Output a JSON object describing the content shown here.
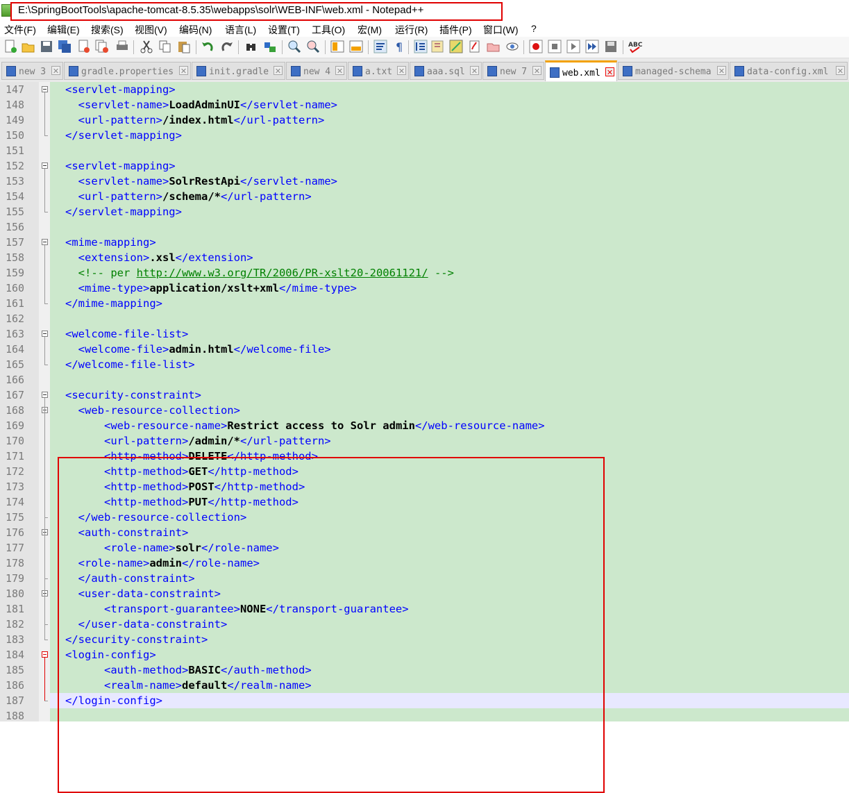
{
  "window": {
    "title": "E:\\SpringBootTools\\apache-tomcat-8.5.35\\webapps\\solr\\WEB-INF\\web.xml - Notepad++"
  },
  "menu": {
    "items": [
      "文件(F)",
      "编辑(E)",
      "搜索(S)",
      "视图(V)",
      "编码(N)",
      "语言(L)",
      "设置(T)",
      "工具(O)",
      "宏(M)",
      "运行(R)",
      "插件(P)",
      "窗口(W)",
      "?"
    ]
  },
  "toolbar": {
    "icons": [
      "new-file-icon",
      "open-file-icon",
      "save-icon",
      "save-all-icon",
      "close-icon",
      "close-all-icon",
      "print-icon",
      "cut-icon",
      "copy-icon",
      "paste-icon",
      "undo-icon",
      "redo-icon",
      "find-icon",
      "replace-icon",
      "zoom-in-icon",
      "zoom-out-icon",
      "sync-vertical-icon",
      "sync-horizontal-icon",
      "word-wrap-icon",
      "show-all-chars-icon",
      "indent-guide-icon",
      "doc-map-icon",
      "function-list-icon",
      "folder-workspace-icon",
      "monitor-icon",
      "record-macro-icon",
      "stop-record-icon",
      "play-macro-icon",
      "run-macro-multiple-icon",
      "save-macro-icon",
      "spellcheck-icon"
    ]
  },
  "tabs": [
    {
      "label": "new 3"
    },
    {
      "label": "gradle.properties"
    },
    {
      "label": "init.gradle"
    },
    {
      "label": "new 4"
    },
    {
      "label": "a.txt"
    },
    {
      "label": "aaa.sql"
    },
    {
      "label": "new 7"
    },
    {
      "label": "web.xml"
    },
    {
      "label": "managed-schema"
    },
    {
      "label": "data-config.xml"
    }
  ],
  "active_tab": "web.xml",
  "colors": {
    "code_background": "#cce8cc",
    "tag": "#0000ff",
    "comment": "#008000",
    "highlight_box": "#e00000",
    "active_tab_accent": "#f3a100"
  },
  "editor": {
    "lines": [
      {
        "n": "147",
        "code": "<servlet-mapping>"
      },
      {
        "n": "148",
        "code": "  <servlet-name>LoadAdminUI</servlet-name>"
      },
      {
        "n": "149",
        "code": "  <url-pattern>/index.html</url-pattern>"
      },
      {
        "n": "150",
        "code": "</servlet-mapping>"
      },
      {
        "n": "151",
        "code": ""
      },
      {
        "n": "152",
        "code": "<servlet-mapping>"
      },
      {
        "n": "153",
        "code": "  <servlet-name>SolrRestApi</servlet-name>"
      },
      {
        "n": "154",
        "code": "  <url-pattern>/schema/*</url-pattern>"
      },
      {
        "n": "155",
        "code": "</servlet-mapping>"
      },
      {
        "n": "156",
        "code": ""
      },
      {
        "n": "157",
        "code": "<mime-mapping>"
      },
      {
        "n": "158",
        "code": "  <extension>.xsl</extension>"
      },
      {
        "n": "159",
        "code": "  <!-- per http://www.w3.org/TR/2006/PR-xslt20-20061121/ -->"
      },
      {
        "n": "160",
        "code": "  <mime-type>application/xslt+xml</mime-type>"
      },
      {
        "n": "161",
        "code": "</mime-mapping>"
      },
      {
        "n": "162",
        "code": ""
      },
      {
        "n": "163",
        "code": "<welcome-file-list>"
      },
      {
        "n": "164",
        "code": "  <welcome-file>admin.html</welcome-file>"
      },
      {
        "n": "165",
        "code": "</welcome-file-list>"
      },
      {
        "n": "166",
        "code": ""
      },
      {
        "n": "167",
        "code": "<security-constraint>"
      },
      {
        "n": "168",
        "code": "  <web-resource-collection>"
      },
      {
        "n": "169",
        "code": "      <web-resource-name>Restrict access to Solr admin</web-resource-name>"
      },
      {
        "n": "170",
        "code": "      <url-pattern>/admin/*</url-pattern>"
      },
      {
        "n": "171",
        "code": "      <http-method>DELETE</http-method>"
      },
      {
        "n": "172",
        "code": "      <http-method>GET</http-method>"
      },
      {
        "n": "173",
        "code": "      <http-method>POST</http-method>"
      },
      {
        "n": "174",
        "code": "      <http-method>PUT</http-method>"
      },
      {
        "n": "175",
        "code": "  </web-resource-collection>"
      },
      {
        "n": "176",
        "code": "  <auth-constraint>"
      },
      {
        "n": "177",
        "code": "      <role-name>solr</role-name>"
      },
      {
        "n": "178",
        "code": "  <role-name>admin</role-name>"
      },
      {
        "n": "179",
        "code": "  </auth-constraint>"
      },
      {
        "n": "180",
        "code": "  <user-data-constraint>"
      },
      {
        "n": "181",
        "code": "      <transport-guarantee>NONE</transport-guarantee>"
      },
      {
        "n": "182",
        "code": "  </user-data-constraint>"
      },
      {
        "n": "183",
        "code": "</security-constraint>"
      },
      {
        "n": "184",
        "code": "<login-config>"
      },
      {
        "n": "185",
        "code": "      <auth-method>BASIC</auth-method>"
      },
      {
        "n": "186",
        "code": "      <realm-name>default</realm-name>"
      },
      {
        "n": "187",
        "code": "</login-config>"
      },
      {
        "n": "188",
        "code": ""
      }
    ]
  }
}
